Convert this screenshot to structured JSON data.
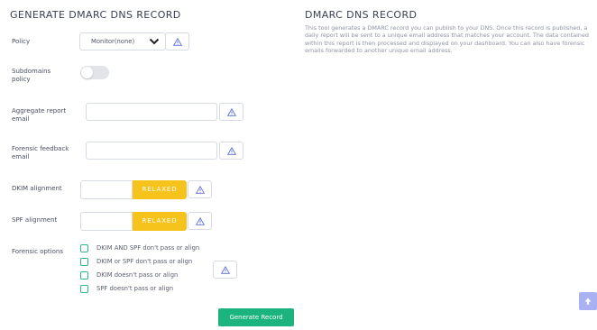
{
  "form": {
    "title": "GENERATE DMARC DNS RECORD",
    "policy_label": "Policy",
    "policy_value": "Monitor(none)",
    "subdomains_label_line1": "Subdomains",
    "subdomains_label_line2": "policy",
    "aggregate_label_line1": "Aggregate report",
    "aggregate_label_line2": "email",
    "aggregate_value": "",
    "forensic_label_line1": "Forensic feedback",
    "forensic_label_line2": "email",
    "forensic_value": "",
    "dkim_label": "DKIM alignment",
    "dkim_value": "",
    "dkim_mode": "RELAXED",
    "spf_label": "SPF alignment",
    "spf_value": "",
    "spf_mode": "RELAXED",
    "forensic_options_label": "Forensic options",
    "options": [
      "DKIM AND SPF don't pass or align",
      "DKIM or SPF don't pass or align",
      "DKIM doesn't pass or align",
      "SPF doesn't pass or align"
    ],
    "generate_button": "Generate Record"
  },
  "info": {
    "title": "DMARC DNS RECORD",
    "description": "This tool generates a DMARC record you can publish to your DNS. Once this record is published, a daily report will be sent to a unique email address that matches your account. The data contained within this report is then processed and displayed on your dashboard. You can also have forensic emails forwarded to another unique email address."
  },
  "icons": {
    "info": "warning-triangle-icon",
    "dropdown": "chevron-down-icon",
    "scroll_top": "arrow-up-icon"
  },
  "colors": {
    "accent_green": "#1cb47e",
    "relaxed_yellow": "#f6c31c",
    "info_icon_blue": "#5b6bd8",
    "scroll_top_bg": "#a9b1f2"
  }
}
